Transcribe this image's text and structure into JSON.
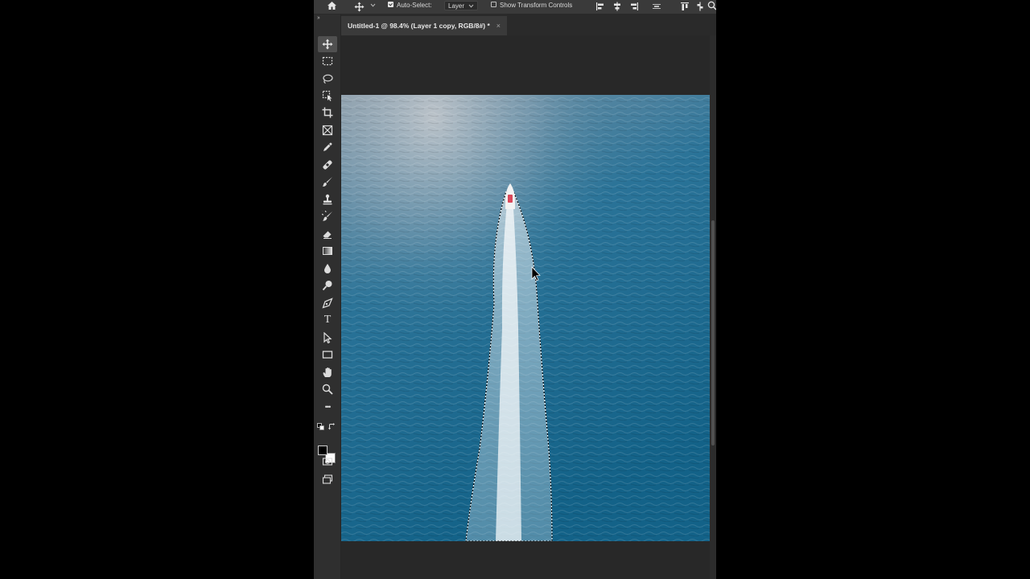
{
  "options_bar": {
    "auto_select_label": "Auto-Select:",
    "auto_select_checked": true,
    "auto_select_target": "Layer",
    "show_transform_label": "Show Transform Controls",
    "show_transform_checked": false
  },
  "document_tab": {
    "title": "Untitled-1 @ 98.4% (Layer 1 copy, RGB/8#) *",
    "close_glyph": "×"
  },
  "toolbar": {
    "collapse_glyph": "››",
    "tools": [
      "move-tool",
      "rectangular-marquee-tool",
      "lasso-tool",
      "object-selection-tool",
      "crop-tool",
      "frame-tool",
      "eyedropper-tool",
      "healing-brush-tool",
      "brush-tool",
      "clone-stamp-tool",
      "history-brush-tool",
      "eraser-tool",
      "gradient-tool",
      "blur-tool",
      "dodge-tool",
      "pen-tool",
      "type-tool",
      "path-selection-tool",
      "rectangle-tool",
      "hand-tool",
      "zoom-tool",
      "edit-toolbar"
    ],
    "active_tool": "move-tool",
    "type_tool_glyph": "T",
    "more_glyph": "•••",
    "foreground_color": "#000000",
    "background_color": "#ffffff"
  },
  "canvas": {
    "image": "aerial-speedboat-wake",
    "water_color": "#1a6a8d",
    "selection": "marching-ants-around-wake"
  },
  "colors": {
    "app_bg": "#323232",
    "workspace_bg": "#282828"
  }
}
